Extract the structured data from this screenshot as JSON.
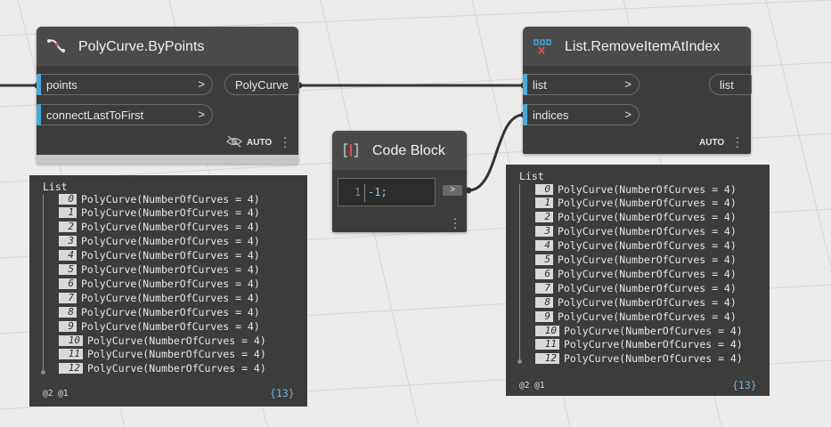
{
  "polycurve_node": {
    "title": "PolyCurve.ByPoints",
    "inputs": [
      "points",
      "connectLastToFirst"
    ],
    "output": "PolyCurve",
    "chevron": ">",
    "lacing": "AUTO",
    "icon": "polycurve-icon",
    "visibility_icon": "eye-hidden-icon"
  },
  "code_block": {
    "title": "Code Block",
    "line_number": "1",
    "code": "-1;",
    "output_chevron": ">",
    "icon": "code-block-icon"
  },
  "remove_node": {
    "title": "List.RemoveItemAtIndex",
    "inputs": [
      "list",
      "indices"
    ],
    "output": "list",
    "chevron": ">",
    "lacing": "AUTO",
    "icon": "list-remove-icon"
  },
  "preview_left": {
    "title": "List",
    "items": [
      {
        "index": "0",
        "text": "PolyCurve(NumberOfCurves = 4)"
      },
      {
        "index": "1",
        "text": "PolyCurve(NumberOfCurves = 4)"
      },
      {
        "index": "2",
        "text": "PolyCurve(NumberOfCurves = 4)"
      },
      {
        "index": "3",
        "text": "PolyCurve(NumberOfCurves = 4)"
      },
      {
        "index": "4",
        "text": "PolyCurve(NumberOfCurves = 4)"
      },
      {
        "index": "5",
        "text": "PolyCurve(NumberOfCurves = 4)"
      },
      {
        "index": "6",
        "text": "PolyCurve(NumberOfCurves = 4)"
      },
      {
        "index": "7",
        "text": "PolyCurve(NumberOfCurves = 4)"
      },
      {
        "index": "8",
        "text": "PolyCurve(NumberOfCurves = 4)"
      },
      {
        "index": "9",
        "text": "PolyCurve(NumberOfCurves = 4)"
      },
      {
        "index": "10",
        "text": "PolyCurve(NumberOfCurves = 4)"
      },
      {
        "index": "11",
        "text": "PolyCurve(NumberOfCurves = 4)"
      },
      {
        "index": "12",
        "text": "PolyCurve(NumberOfCurves = 4)"
      }
    ],
    "levels": "@2 @1",
    "count": "{13}"
  },
  "preview_right": {
    "title": "List",
    "items": [
      {
        "index": "0",
        "text": "PolyCurve(NumberOfCurves = 4)"
      },
      {
        "index": "1",
        "text": "PolyCurve(NumberOfCurves = 4)"
      },
      {
        "index": "2",
        "text": "PolyCurve(NumberOfCurves = 4)"
      },
      {
        "index": "3",
        "text": "PolyCurve(NumberOfCurves = 4)"
      },
      {
        "index": "4",
        "text": "PolyCurve(NumberOfCurves = 4)"
      },
      {
        "index": "5",
        "text": "PolyCurve(NumberOfCurves = 4)"
      },
      {
        "index": "6",
        "text": "PolyCurve(NumberOfCurves = 4)"
      },
      {
        "index": "7",
        "text": "PolyCurve(NumberOfCurves = 4)"
      },
      {
        "index": "8",
        "text": "PolyCurve(NumberOfCurves = 4)"
      },
      {
        "index": "9",
        "text": "PolyCurve(NumberOfCurves = 4)"
      },
      {
        "index": "10",
        "text": "PolyCurve(NumberOfCurves = 4)"
      },
      {
        "index": "11",
        "text": "PolyCurve(NumberOfCurves = 4)"
      },
      {
        "index": "12",
        "text": "PolyCurve(NumberOfCurves = 4)"
      }
    ],
    "levels": "@2 @1",
    "count": "{13}"
  },
  "colors": {
    "canvas_bg": "#ececec",
    "node_bg": "#3c3c3c",
    "node_header": "#4a4a4a",
    "port_accent": "#4ba9d6",
    "wire": "#333333",
    "count_text": "#6fb2e0"
  }
}
